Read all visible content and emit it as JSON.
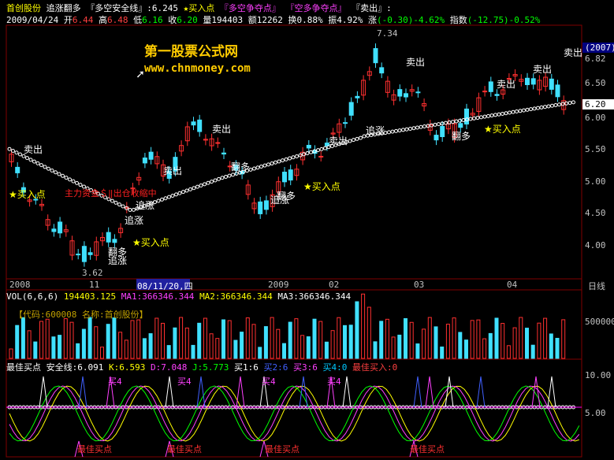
{
  "header": {
    "line1": [
      "首创股份",
      "追涨翻多",
      "『多空安全线』:6.245",
      "★买入点",
      "『多空争夺点』",
      "『空多争夺点』",
      "『卖出』:"
    ],
    "line2": {
      "date": "2009/04/24",
      "open_l": "开",
      "open": "6.44",
      "high_l": "高",
      "high": "6.48",
      "low_l": "低",
      "low": "6.16",
      "close_l": "收",
      "close": "6.20",
      "vol_l": "量",
      "vol": "194403",
      "amt_l": "额",
      "amt": "12262",
      "turn_l": "换",
      "turn": "0.88%",
      "amp_l": "振",
      "amp": "4.92%",
      "chg_l": "涨",
      "chg": "(-0.30)-4.62%",
      "idx_l": "指数",
      "idx": "(-12.75)-0.52%"
    }
  },
  "watermark": {
    "title": "第一股票公式网",
    "url": "www.chnmoney.com"
  },
  "price_axis": {
    "ticks": [
      "6.50",
      "6.00",
      "5.50",
      "5.00",
      "4.50",
      "4.00"
    ],
    "current": "6.20",
    "top": "6.82",
    "badge": "(2007)"
  },
  "annotations": {
    "hi": "7.34",
    "lo": "3.62",
    "sell": "卖出",
    "buy": "★买入点",
    "flip": "翻多",
    "chase": "追涨",
    "red_text": "主力资金＄‖出仓收缩中"
  },
  "date_axis": {
    "labels": [
      "2008",
      "11",
      "08/11/20,四",
      "2009",
      "02",
      "03",
      "04"
    ],
    "period": "日线"
  },
  "vol_panel": {
    "title": "VOL(6,6,6)",
    "value": "194403.125",
    "ma1": "MA1:366346.344",
    "ma2": "MA2:366346.344",
    "ma3": "MA3:366346.344",
    "code_line": "【代码:600008 名称:首创股份】",
    "tick": "500000"
  },
  "ind_panel": {
    "name": "最佳买点",
    "safe": "安全线:6.091",
    "k": "K:6.593",
    "d": "D:7.048",
    "j": "J:5.773",
    "b1": "买1:6",
    "b2": "买2:6",
    "b3": "买3:6",
    "b4": "买4:0",
    "best": "最佳买入:0",
    "ticks": [
      "10.00",
      "5.00"
    ],
    "label_buy4": "买4",
    "label_best": "最佳买点"
  },
  "colors": {
    "up": "#ff3030",
    "down": "#40e0ff",
    "dots": "#ffffff",
    "frame": "#800000"
  }
}
